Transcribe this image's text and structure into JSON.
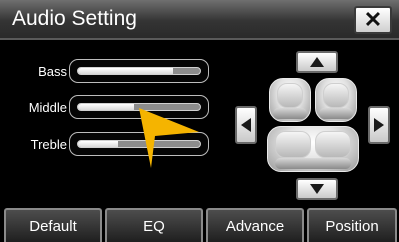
{
  "header": {
    "title": "Audio Setting",
    "close_symbol": "✕",
    "close_icon": "close-icon"
  },
  "sliders": [
    {
      "label": "Bass",
      "level": 0.78
    },
    {
      "label": "Middle",
      "level": 0.46
    },
    {
      "label": "Treble",
      "level": 0.33
    }
  ],
  "seat_control": {
    "up_icon": "triangle-up-icon",
    "down_icon": "triangle-down-icon",
    "left_icon": "triangle-left-icon",
    "right_icon": "triangle-right-icon"
  },
  "tabs": [
    {
      "label": "Default"
    },
    {
      "label": "EQ"
    },
    {
      "label": "Advance"
    },
    {
      "label": "Position"
    }
  ],
  "colors": {
    "pointer": "#f5b400",
    "background": "#000000"
  }
}
